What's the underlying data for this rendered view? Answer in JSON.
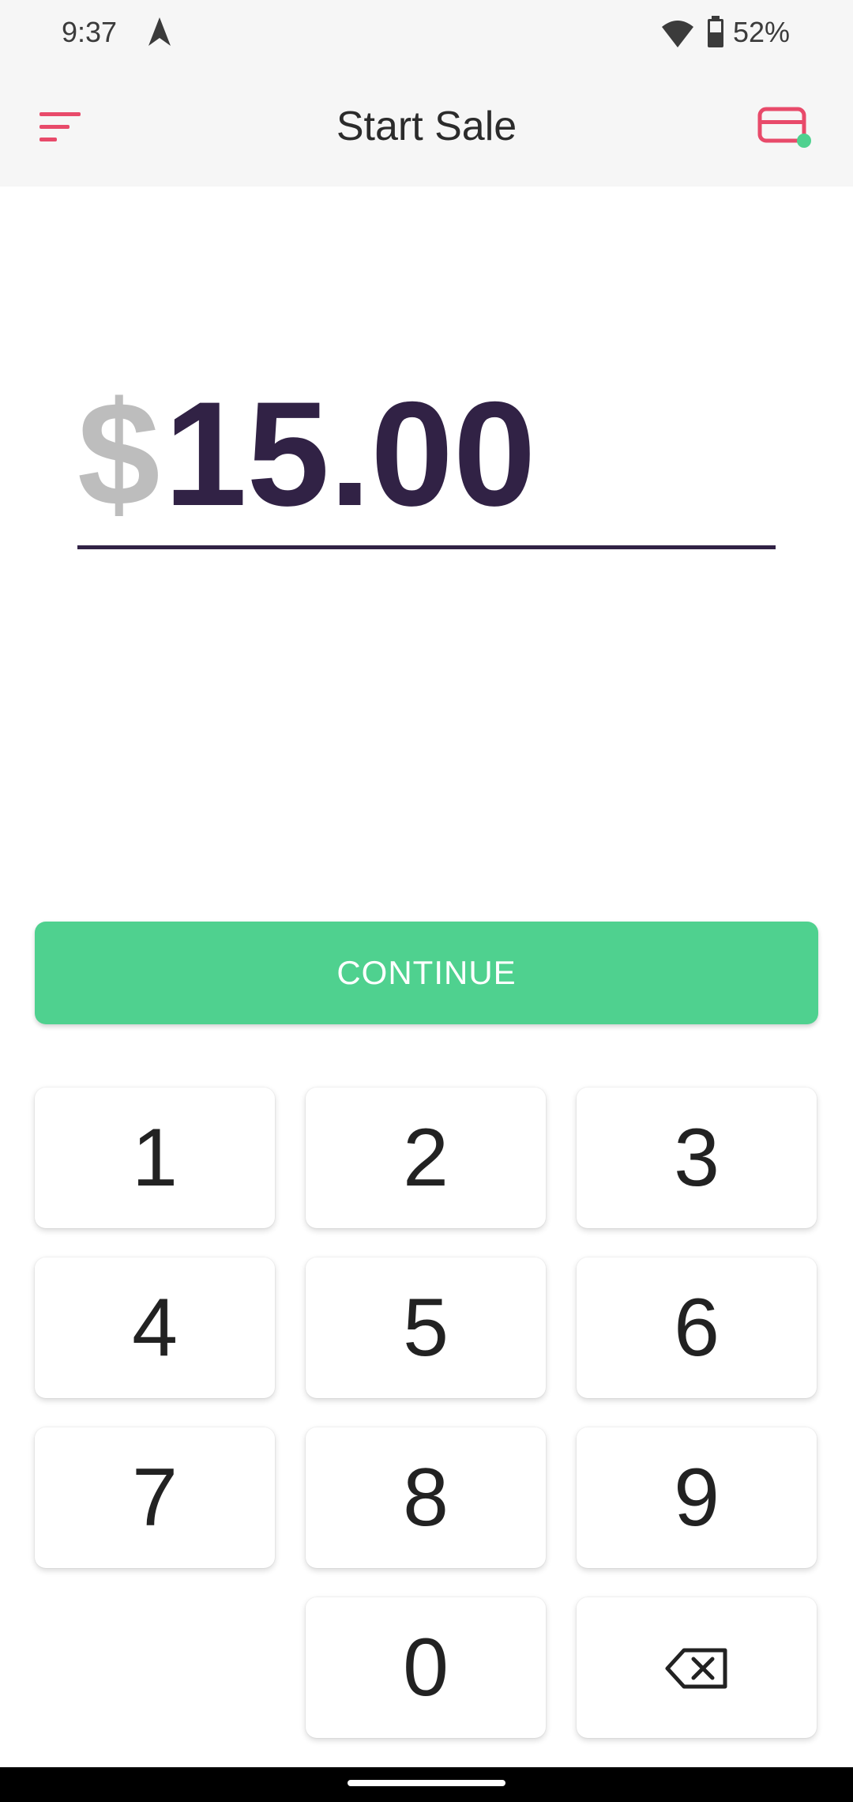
{
  "status_bar": {
    "time": "9:37",
    "battery": "52%",
    "icons": [
      "navigation-arrow-icon",
      "wifi-icon",
      "battery-icon"
    ]
  },
  "app_bar": {
    "title": "Start Sale",
    "menu_icon": "sort-menu-icon",
    "right_icon": "card-reader-icon",
    "accent_color": "#e84a6a",
    "status_dot_color": "#4fd18f"
  },
  "amount": {
    "currency": "$",
    "value": "15.00",
    "value_color": "#312245",
    "currency_color": "#bdbdbd"
  },
  "continue": {
    "label": "CONTINUE",
    "color": "#4fd18f"
  },
  "keypad": {
    "keys": [
      "1",
      "2",
      "3",
      "4",
      "5",
      "6",
      "7",
      "8",
      "9",
      "0"
    ],
    "backspace_icon": "backspace-icon"
  }
}
